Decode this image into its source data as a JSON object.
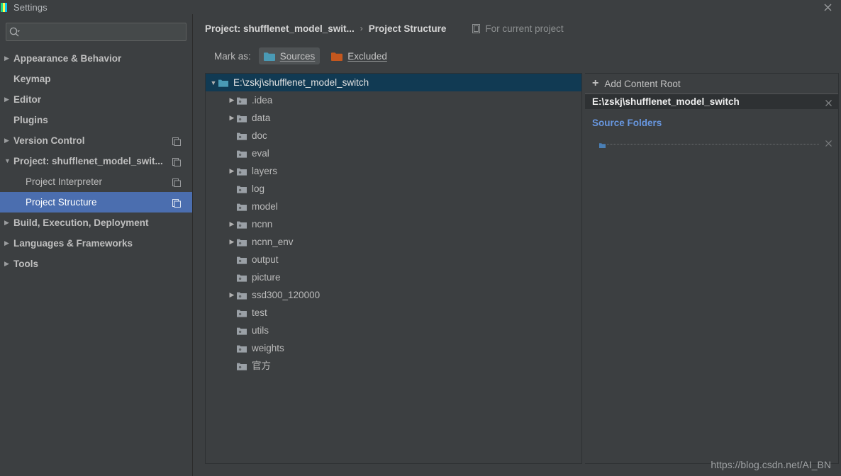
{
  "window": {
    "title": "Settings",
    "close_label": "✕",
    "logo_icon": "pycharm-logo-icon"
  },
  "sidebar": {
    "search": {
      "placeholder": "",
      "value": "",
      "icon": "search-icon"
    },
    "items": [
      {
        "label": "Appearance & Behavior",
        "arrow": "▶",
        "level": "top",
        "expandable": true,
        "selected": false,
        "copy": false
      },
      {
        "label": "Keymap",
        "arrow": "",
        "level": "top",
        "expandable": false,
        "selected": false,
        "copy": false
      },
      {
        "label": "Editor",
        "arrow": "▶",
        "level": "top",
        "expandable": true,
        "selected": false,
        "copy": false
      },
      {
        "label": "Plugins",
        "arrow": "",
        "level": "top",
        "expandable": false,
        "selected": false,
        "copy": false
      },
      {
        "label": "Version Control",
        "arrow": "▶",
        "level": "top",
        "expandable": true,
        "selected": false,
        "copy": true
      },
      {
        "label": "Project: shufflenet_model_swit...",
        "arrow": "▼",
        "level": "top",
        "expandable": true,
        "selected": false,
        "copy": true
      },
      {
        "label": "Project Interpreter",
        "arrow": "",
        "level": "sub",
        "expandable": false,
        "selected": false,
        "copy": true
      },
      {
        "label": "Project Structure",
        "arrow": "",
        "level": "sub",
        "expandable": false,
        "selected": true,
        "copy": true
      },
      {
        "label": "Build, Execution, Deployment",
        "arrow": "▶",
        "level": "top",
        "expandable": true,
        "selected": false,
        "copy": false
      },
      {
        "label": "Languages & Frameworks",
        "arrow": "▶",
        "level": "top",
        "expandable": true,
        "selected": false,
        "copy": false
      },
      {
        "label": "Tools",
        "arrow": "▶",
        "level": "top",
        "expandable": false,
        "selected": false,
        "copy": false
      }
    ]
  },
  "breadcrumb": {
    "project": "Project: shufflenet_model_swit...",
    "separator": "›",
    "current": "Project Structure",
    "scope_label": "For current project",
    "scope_icon": "copy-scope-icon"
  },
  "mark_as": {
    "label": "Mark as:",
    "buttons": [
      {
        "label": "Sources",
        "color": "#4a9ab5",
        "active": true,
        "icon": "folder-sources-icon"
      },
      {
        "label": "Excluded",
        "color": "#c4571e",
        "active": false,
        "icon": "folder-excluded-icon"
      }
    ]
  },
  "tree": {
    "rows": [
      {
        "label": "E:\\zskj\\shufflenet_model_switch",
        "indent": 0,
        "expandable": true,
        "expanded": true,
        "selected": true,
        "icon_color": "#4a9ab5"
      },
      {
        "label": ".idea",
        "indent": 1,
        "expandable": true,
        "expanded": false,
        "selected": false,
        "icon_color": "#9aa0a6"
      },
      {
        "label": "data",
        "indent": 1,
        "expandable": true,
        "expanded": false,
        "selected": false,
        "icon_color": "#9aa0a6"
      },
      {
        "label": "doc",
        "indent": 1,
        "expandable": false,
        "expanded": false,
        "selected": false,
        "icon_color": "#9aa0a6"
      },
      {
        "label": "eval",
        "indent": 1,
        "expandable": false,
        "expanded": false,
        "selected": false,
        "icon_color": "#9aa0a6"
      },
      {
        "label": "layers",
        "indent": 1,
        "expandable": true,
        "expanded": false,
        "selected": false,
        "icon_color": "#9aa0a6"
      },
      {
        "label": "log",
        "indent": 1,
        "expandable": false,
        "expanded": false,
        "selected": false,
        "icon_color": "#9aa0a6"
      },
      {
        "label": "model",
        "indent": 1,
        "expandable": false,
        "expanded": false,
        "selected": false,
        "icon_color": "#9aa0a6"
      },
      {
        "label": "ncnn",
        "indent": 1,
        "expandable": true,
        "expanded": false,
        "selected": false,
        "icon_color": "#9aa0a6"
      },
      {
        "label": "ncnn_env",
        "indent": 1,
        "expandable": true,
        "expanded": false,
        "selected": false,
        "icon_color": "#9aa0a6"
      },
      {
        "label": "output",
        "indent": 1,
        "expandable": false,
        "expanded": false,
        "selected": false,
        "icon_color": "#9aa0a6"
      },
      {
        "label": "picture",
        "indent": 1,
        "expandable": false,
        "expanded": false,
        "selected": false,
        "icon_color": "#9aa0a6"
      },
      {
        "label": "ssd300_120000",
        "indent": 1,
        "expandable": true,
        "expanded": false,
        "selected": false,
        "icon_color": "#9aa0a6"
      },
      {
        "label": "test",
        "indent": 1,
        "expandable": false,
        "expanded": false,
        "selected": false,
        "icon_color": "#9aa0a6"
      },
      {
        "label": "utils",
        "indent": 1,
        "expandable": false,
        "expanded": false,
        "selected": false,
        "icon_color": "#9aa0a6"
      },
      {
        "label": "weights",
        "indent": 1,
        "expandable": false,
        "expanded": false,
        "selected": false,
        "icon_color": "#9aa0a6"
      },
      {
        "label": "官方",
        "indent": 1,
        "expandable": false,
        "expanded": false,
        "selected": false,
        "icon_color": "#9aa0a6"
      }
    ]
  },
  "right_panel": {
    "add_content_root": "Add Content Root",
    "add_icon": "plus-icon",
    "content_root": "E:\\zskj\\shufflenet_model_switch",
    "content_root_remove_icon": "close-icon",
    "source_folders_title": "Source Folders",
    "source_row_remove_icon": "close-icon"
  },
  "watermark": "https://blog.csdn.net/AI_BN",
  "colors": {
    "background": "#3c3f41",
    "selection_blue": "#4b6eaf",
    "tree_selection": "#113a53",
    "accent_link": "#6897e0",
    "sources_teal": "#4a9ab5",
    "excluded_orange": "#c4571e"
  }
}
